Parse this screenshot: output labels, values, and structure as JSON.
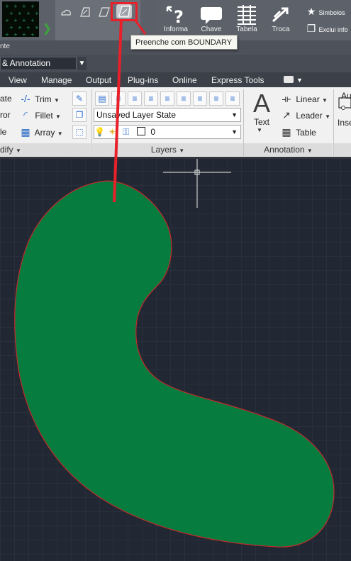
{
  "quick_tools": {
    "items": [
      {
        "icon": "cloud-revision-icon"
      },
      {
        "icon": "hatch-edit-icon"
      },
      {
        "icon": "wipeout-icon"
      },
      {
        "icon": "boundary-hatch-icon",
        "highlighted": true
      }
    ],
    "tooltip": "Preenche com BOUNDARY"
  },
  "custom_tools": [
    {
      "label": "Informa",
      "icon": "inquiry-icon"
    },
    {
      "label": "Chave",
      "icon": "speech-bubble-icon"
    },
    {
      "label": "Tabela",
      "icon": "table-icon"
    },
    {
      "label": "Troca",
      "icon": "swap-arrow-icon"
    }
  ],
  "side_tools": [
    {
      "label": "Simbolos",
      "icon": "star-icon"
    },
    {
      "label": "Exclui info",
      "icon": "erase-info-icon"
    }
  ],
  "status_text": "nte",
  "workspace": {
    "value": "& Annotation"
  },
  "ribbon_tabs": [
    "View",
    "Manage",
    "Output",
    "Plug-ins",
    "Online",
    "Express Tools"
  ],
  "modify_panel": {
    "title": "dify",
    "left_labels": [
      "ate",
      "ror",
      "le"
    ],
    "tools": [
      {
        "label": "Trim",
        "icon": "trim-icon"
      },
      {
        "label": "Fillet",
        "icon": "fillet-icon"
      },
      {
        "label": "Array",
        "icon": "array-icon"
      }
    ]
  },
  "layers_panel": {
    "title": "Layers",
    "layer_state": "Unsaved Layer State",
    "current_layer": "0"
  },
  "annotation_panel": {
    "title": "Annotation",
    "text_label": "Text",
    "tools": [
      {
        "label": "Linear",
        "icon": "linear-dimension-icon"
      },
      {
        "label": "Leader",
        "icon": "leader-icon"
      },
      {
        "label": "Table",
        "icon": "table-icon"
      }
    ]
  },
  "insert_panel": {
    "label": "Inse",
    "top_label": "Au"
  },
  "colors": {
    "hatch_fill": "#067c3f",
    "hatch_outline": "#c42a2a",
    "annotation_red": "#e8202a",
    "canvas_bg": "#222833"
  }
}
